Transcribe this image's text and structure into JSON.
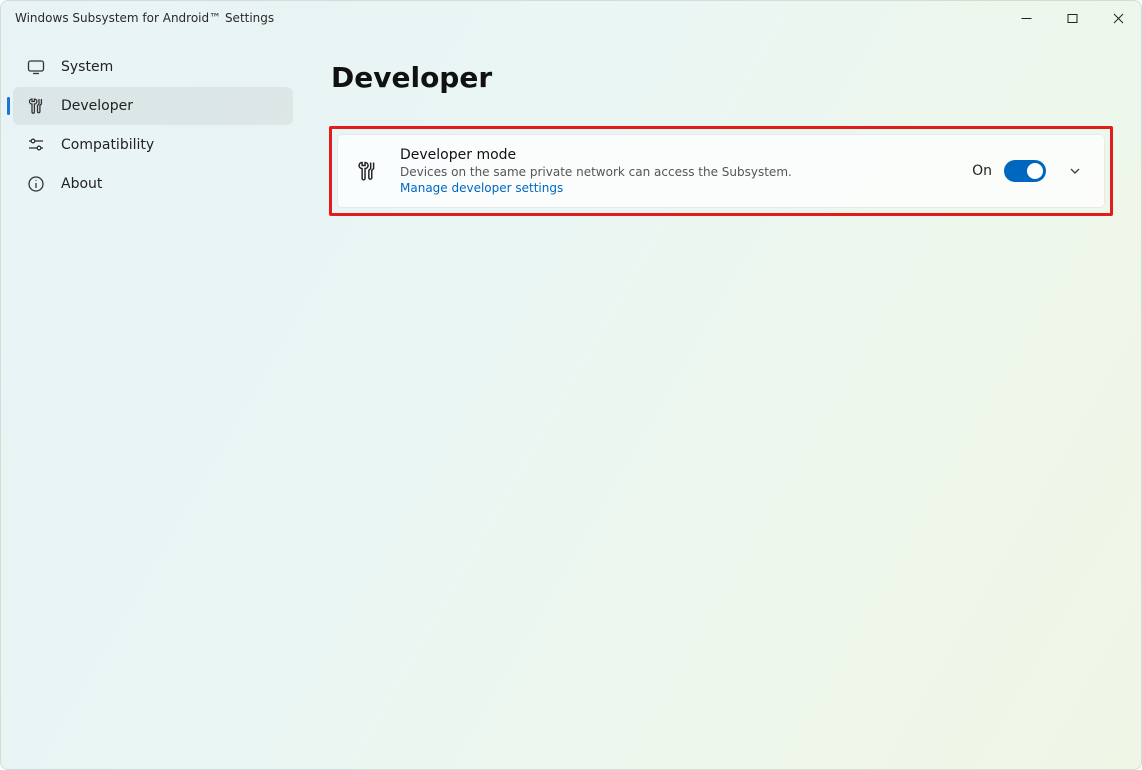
{
  "window": {
    "title": "Windows Subsystem for Android™ Settings"
  },
  "sidebar": {
    "items": [
      {
        "label": "System",
        "active": false
      },
      {
        "label": "Developer",
        "active": true
      },
      {
        "label": "Compatibility",
        "active": false
      },
      {
        "label": "About",
        "active": false
      }
    ]
  },
  "page": {
    "title": "Developer"
  },
  "card": {
    "title": "Developer mode",
    "subtitle": "Devices on the same private network can access the Subsystem.",
    "link_label": "Manage developer settings",
    "toggle_state_label": "On",
    "toggle_on": true
  },
  "colors": {
    "accent": "#0067c0",
    "highlight_border": "#e21b1b"
  }
}
